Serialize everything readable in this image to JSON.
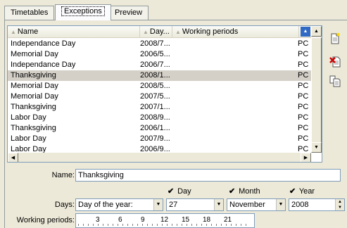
{
  "tabs": [
    {
      "label": "Timetables",
      "active": false
    },
    {
      "label": "Exceptions",
      "active": true
    },
    {
      "label": "Preview",
      "active": false
    }
  ],
  "grid": {
    "headers": {
      "name": "Name",
      "day": "Day...",
      "working": "Working periods"
    },
    "rows": [
      {
        "name": "Independance Day",
        "day": "2008/7...",
        "working": "",
        "code": "PC",
        "selected": false
      },
      {
        "name": "Memorial Day",
        "day": "2006/5...",
        "working": "",
        "code": "PC",
        "selected": false
      },
      {
        "name": "Independance Day",
        "day": "2006/7...",
        "working": "",
        "code": "PC",
        "selected": false
      },
      {
        "name": "Thanksgiving",
        "day": "2008/1...",
        "working": "",
        "code": "PC",
        "selected": true
      },
      {
        "name": "Memorial Day",
        "day": "2008/5...",
        "working": "",
        "code": "PC",
        "selected": false
      },
      {
        "name": "Memorial Day",
        "day": "2007/5...",
        "working": "",
        "code": "PC",
        "selected": false
      },
      {
        "name": "Thanksgiving",
        "day": "2007/1...",
        "working": "",
        "code": "PC",
        "selected": false
      },
      {
        "name": "Labor Day",
        "day": "2008/9...",
        "working": "",
        "code": "PC",
        "selected": false
      },
      {
        "name": "Thanksgiving",
        "day": "2006/1...",
        "working": "",
        "code": "PC",
        "selected": false
      },
      {
        "name": "Labor Day",
        "day": "2007/9...",
        "working": "",
        "code": "PC",
        "selected": false
      },
      {
        "name": "Labor Day",
        "day": "2006/9...",
        "working": "",
        "code": "PC",
        "selected": false
      }
    ]
  },
  "toolbar": {
    "new_icon": "new-document-icon",
    "delete_icon": "delete-icon",
    "copy_icon": "copy-icon"
  },
  "form": {
    "name_label": "Name:",
    "name_value": "Thanksgiving",
    "day_check_label": "Day",
    "month_check_label": "Month",
    "year_check_label": "Year",
    "days_label": "Days:",
    "days_type_value": "Day of the year:",
    "day_value": "27",
    "month_value": "November",
    "year_value": "2008",
    "working_periods_label": "Working periods:",
    "ruler_ticks": [
      "3",
      "6",
      "9",
      "12",
      "15",
      "18",
      "21"
    ]
  },
  "colors": {
    "selected_row": "#d4d0c8",
    "sort_indicator": "#316ac5",
    "delete_icon": "#cc0000"
  }
}
